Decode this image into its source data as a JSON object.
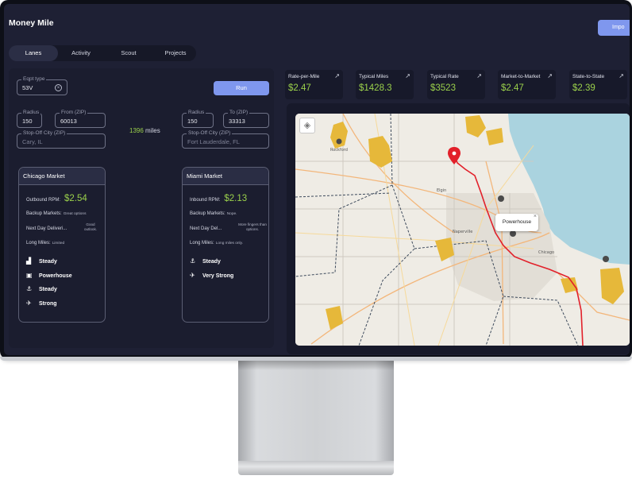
{
  "app": {
    "title": "Money Mile",
    "import_label": "Impo"
  },
  "tabs": [
    {
      "label": "Lanes",
      "active": true
    },
    {
      "label": "Activity",
      "active": false
    },
    {
      "label": "Scout",
      "active": false
    },
    {
      "label": "Projects",
      "active": false
    }
  ],
  "search": {
    "equipment_label": "Eqpt type",
    "equipment_value": "53V",
    "run_label": "Run",
    "origin": {
      "radius_label": "Radius",
      "radius_value": "150",
      "zip_label": "From (ZIP)",
      "zip_value": "60013",
      "stopoff_label": "Stop-Off City (ZIP)",
      "stopoff_placeholder": "Cary, IL"
    },
    "destination": {
      "radius_label": "Radius",
      "radius_value": "150",
      "zip_label": "To (ZIP)",
      "zip_value": "33313",
      "stopoff_label": "Stop-Off City (ZIP)",
      "stopoff_placeholder": "Fort Lauderdale, FL"
    },
    "distance_value": "1396",
    "distance_unit": "miles"
  },
  "origin_market": {
    "title": "Chicago Market",
    "rpm_label": "Outbound RPM:",
    "rpm_value": "$2.54",
    "backup_label": "Backup Markets:",
    "backup_value": "Great options",
    "nextday_label": "Next Day Deliveri...",
    "nextday_value_line1": "Good",
    "nextday_value_line2": "outlook.",
    "longmiles_label": "Long Miles:",
    "longmiles_value": "Limited",
    "trends": [
      {
        "icon": "factory-icon",
        "glyph": "▟",
        "label": "Steady"
      },
      {
        "icon": "warehouse-icon",
        "glyph": "▣",
        "label": "Powerhouse"
      },
      {
        "icon": "anchor-icon",
        "glyph": "⚓",
        "label": "Steady"
      },
      {
        "icon": "airplane-icon",
        "glyph": "✈",
        "label": "Strong"
      }
    ]
  },
  "destination_market": {
    "title": "Miami Market",
    "rpm_label": "Inbound RPM:",
    "rpm_value": "$2.13",
    "backup_label": "Backup Markets:",
    "backup_value": "Nope.",
    "nextday_label": "Next Day Del...",
    "nextday_value_line1": "More fingers than",
    "nextday_value_line2": "options.",
    "longmiles_label": "Long Miles:",
    "longmiles_value": "Long miles only.",
    "trends": [
      {
        "icon": "anchor-icon",
        "glyph": "⚓",
        "label": "Steady"
      },
      {
        "icon": "airplane-icon",
        "glyph": "✈",
        "label": "Very Strong"
      }
    ]
  },
  "stats": [
    {
      "label": "Rate-per-Mile",
      "value": "$2.47",
      "icon": "trend-up-icon"
    },
    {
      "label": "Typical Miles",
      "value": "$1428.3",
      "icon": "trend-up-icon"
    },
    {
      "label": "Typical Rate",
      "value": "$3523",
      "icon": "trend-up-icon"
    },
    {
      "label": "Market-to-Market",
      "value": "$2.47",
      "icon": "trend-up-icon"
    },
    {
      "label": "State-to-State",
      "value": "$2.39",
      "icon": "trend-up-icon"
    }
  ],
  "map": {
    "popup_label": "Powerhouse",
    "popup_close": "×",
    "place_labels": [
      "Rockford",
      "Elgin",
      "Naperville",
      "Chicago"
    ],
    "colors": {
      "accent": "#7f97ee",
      "positive": "#9ad04b",
      "route": "#e2202a",
      "lake": "#aad3df",
      "region": "#e6b83a"
    }
  }
}
